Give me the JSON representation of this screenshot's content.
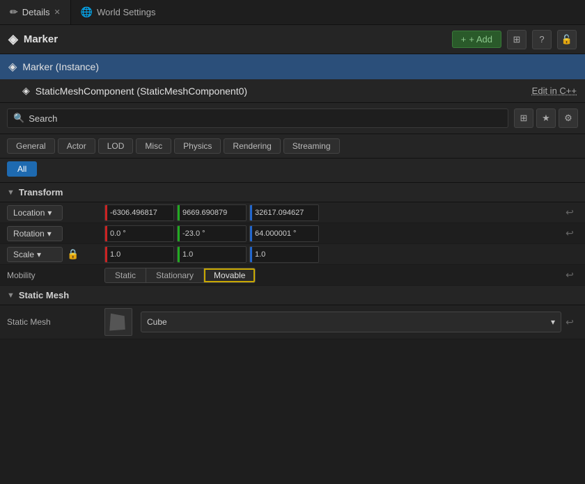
{
  "tabs": [
    {
      "id": "details",
      "label": "Details",
      "active": true,
      "closable": true
    },
    {
      "id": "world-settings",
      "label": "World Settings",
      "active": false,
      "closable": false
    }
  ],
  "header": {
    "title": "Marker",
    "add_label": "+ Add"
  },
  "components": {
    "instance": {
      "label": "Marker (Instance)",
      "sub_label": "StaticMeshComponent (StaticMeshComponent0)",
      "edit_cpp": "Edit in C++"
    }
  },
  "search": {
    "placeholder": "Search"
  },
  "filter_tabs": [
    {
      "id": "general",
      "label": "General"
    },
    {
      "id": "actor",
      "label": "Actor"
    },
    {
      "id": "lod",
      "label": "LOD"
    },
    {
      "id": "misc",
      "label": "Misc"
    },
    {
      "id": "physics",
      "label": "Physics"
    },
    {
      "id": "rendering",
      "label": "Rendering"
    },
    {
      "id": "streaming",
      "label": "Streaming"
    }
  ],
  "all_label": "All",
  "transform": {
    "section_label": "Transform",
    "location": {
      "label": "Location",
      "x": "-6306.496817",
      "y": "9669.690879",
      "z": "32617.094627"
    },
    "rotation": {
      "label": "Rotation",
      "x": "0.0 °",
      "y": "-23.0 °",
      "z": "64.000001 °"
    },
    "scale": {
      "label": "Scale",
      "x": "1.0",
      "y": "1.0",
      "z": "1.0"
    },
    "mobility": {
      "label": "Mobility",
      "options": [
        "Static",
        "Stationary",
        "Movable"
      ],
      "active": "Movable"
    }
  },
  "static_mesh": {
    "section_label": "Static Mesh",
    "label": "Static Mesh",
    "value": "Cube"
  },
  "icons": {
    "search": "🔍",
    "grid": "⊞",
    "star": "★",
    "gear": "⚙",
    "dropdown_arrow": "▾",
    "reset": "↩",
    "cube": "◼",
    "close": "✕",
    "lock": "🔒",
    "globe": "🌐",
    "pen": "✏",
    "add": "+",
    "triangle_down": "▼",
    "triangle_right": "▶",
    "link": "🔗",
    "help": "?"
  }
}
